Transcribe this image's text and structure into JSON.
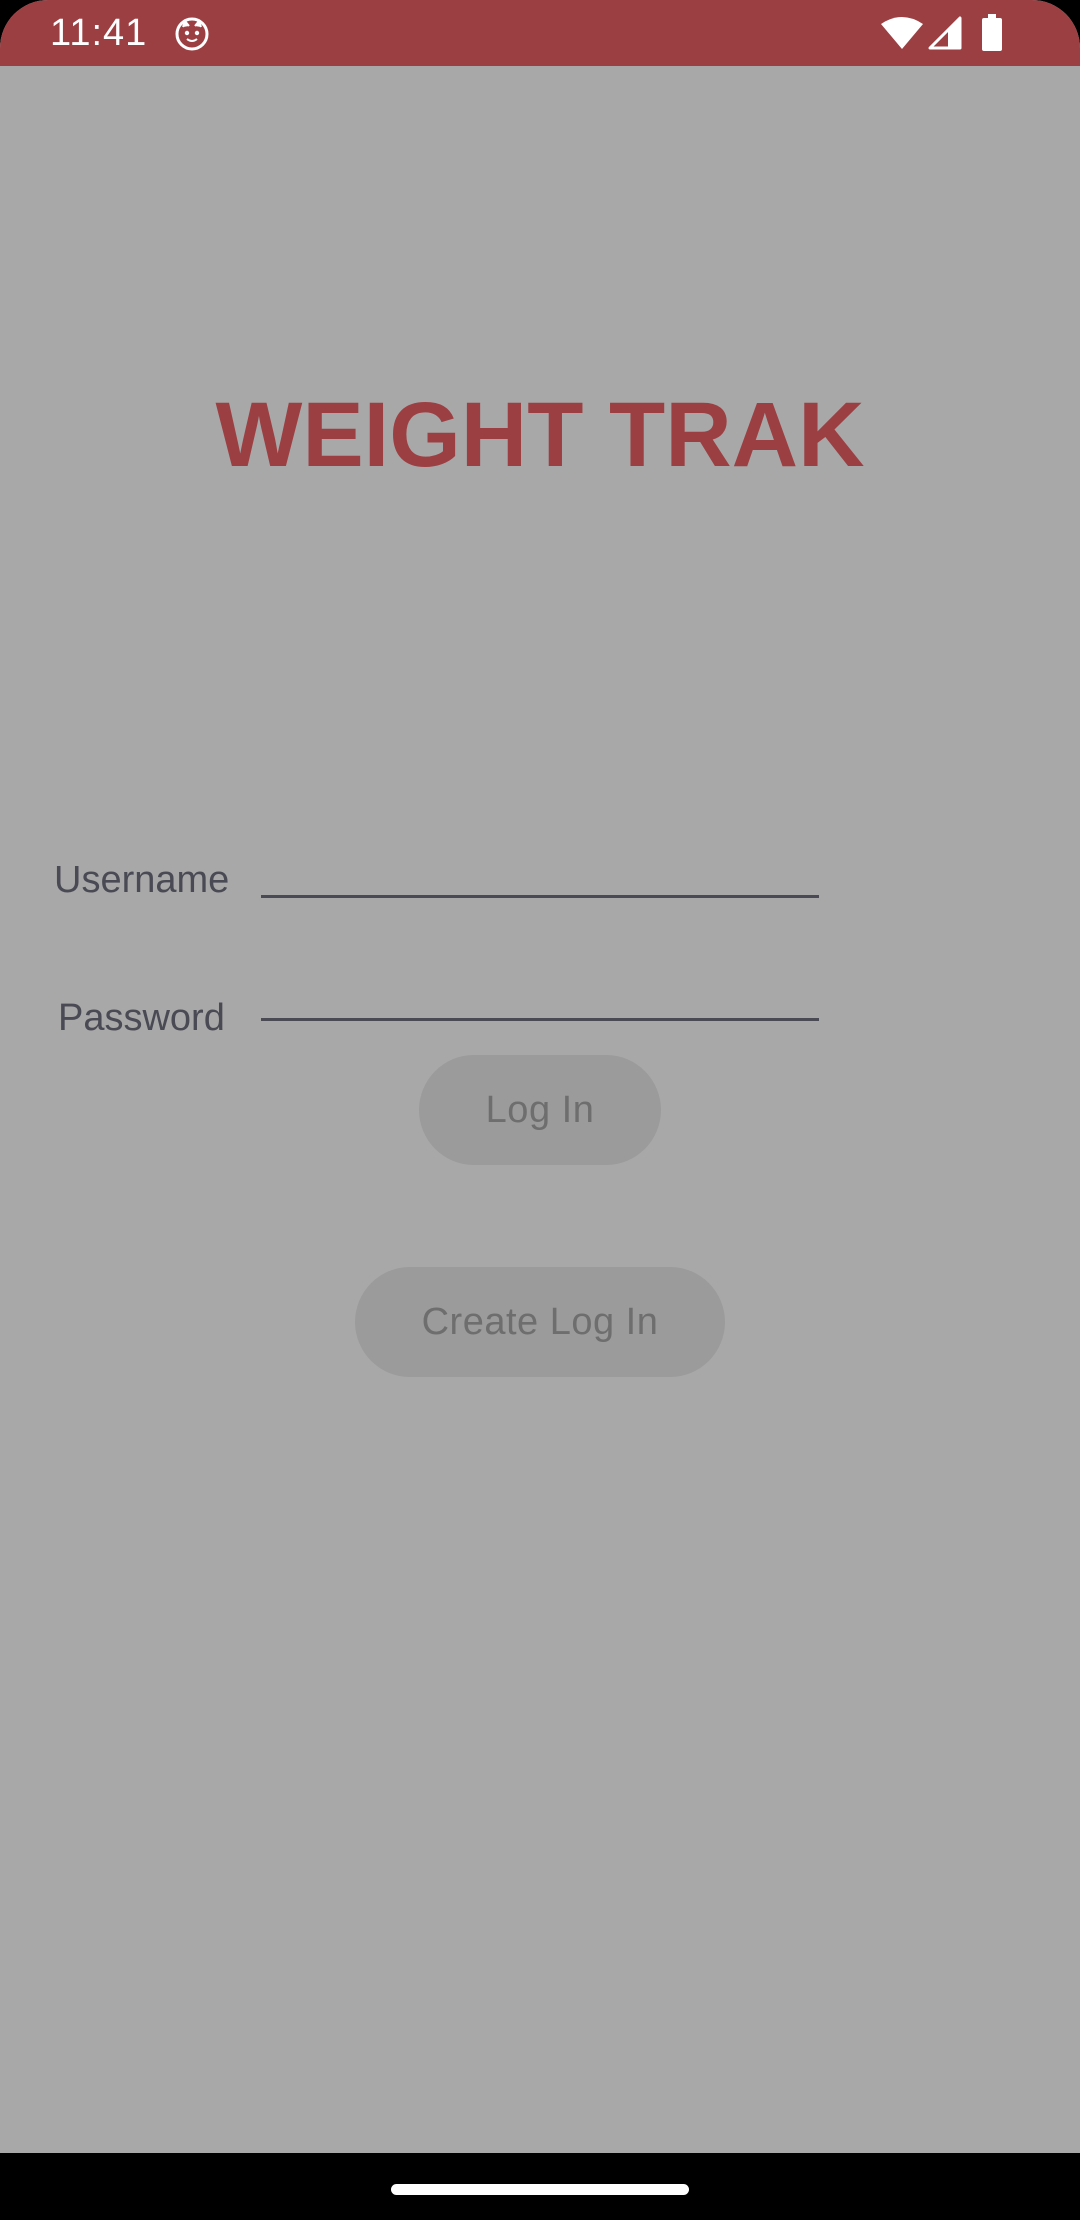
{
  "status_bar": {
    "time": "11:41",
    "app_icon": "cat-face-icon",
    "wifi_icon": "wifi-icon",
    "signal_icon": "cell-signal-icon",
    "battery_icon": "battery-icon",
    "background_color": "#9c3f42"
  },
  "app": {
    "title": "WEIGHT TRAK",
    "title_color": "#9c3f42",
    "background_color": "#a8a8a8"
  },
  "form": {
    "username_label": "Username",
    "username_value": "",
    "password_label": "Password",
    "password_value": "",
    "login_button": "Log In",
    "create_button": "Create Log In"
  },
  "nav_bar": {
    "home_indicator": "home-indicator"
  }
}
